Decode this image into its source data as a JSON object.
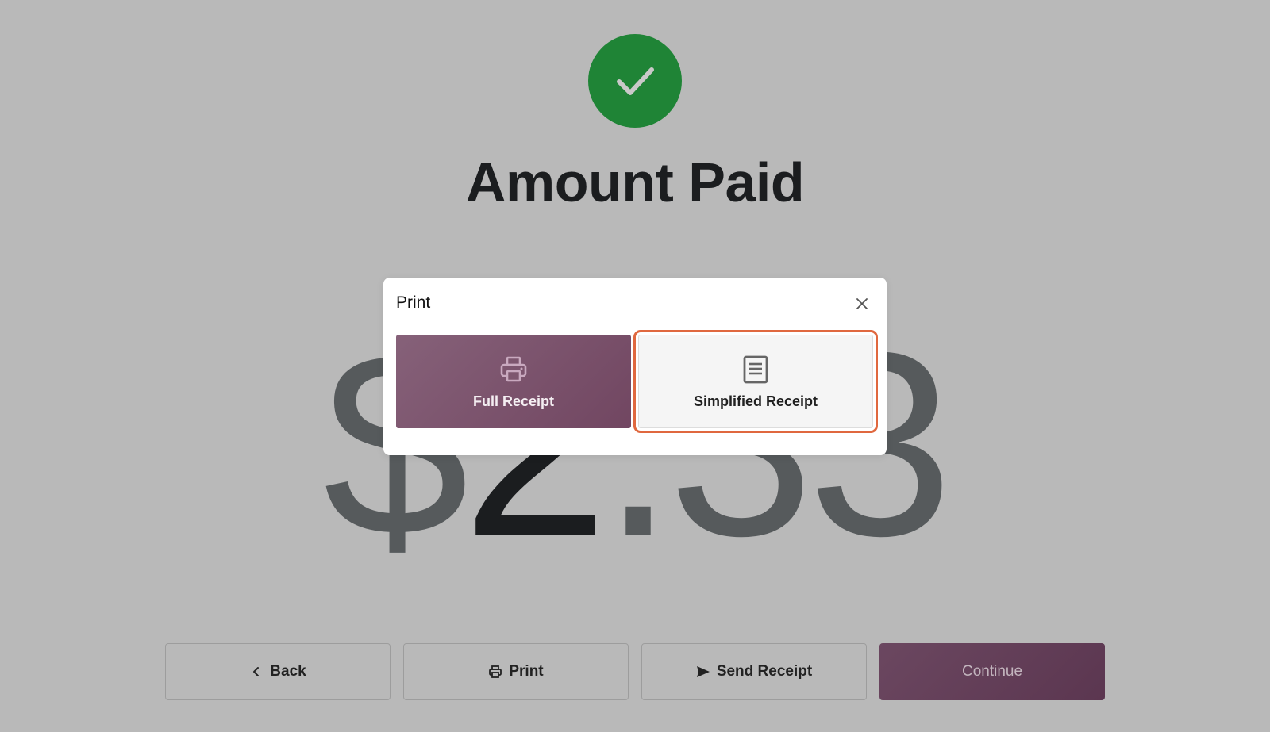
{
  "header": {
    "title": "Amount Paid"
  },
  "amount": {
    "currency": "$",
    "integer": "2",
    "separator": ".",
    "decimals": "33"
  },
  "modal": {
    "title": "Print",
    "options": [
      {
        "label": "Full Receipt",
        "icon": "printer-icon"
      },
      {
        "label": "Simplified Receipt",
        "icon": "receipt-icon"
      }
    ]
  },
  "actions": {
    "back": "Back",
    "print": "Print",
    "send_receipt": "Send Receipt",
    "continue": "Continue"
  },
  "colors": {
    "success": "#1f8436",
    "brand": "#714661",
    "focus_ring": "#e0683f",
    "overlay_background": "#b9b9b9"
  }
}
